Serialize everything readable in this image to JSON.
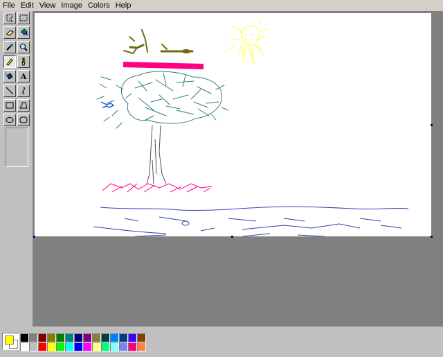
{
  "menu": {
    "items": [
      {
        "id": "file",
        "label": "File"
      },
      {
        "id": "edit",
        "label": "Edit"
      },
      {
        "id": "view",
        "label": "View"
      },
      {
        "id": "image",
        "label": "Image"
      },
      {
        "id": "colors",
        "label": "Colors"
      },
      {
        "id": "help",
        "label": "Help"
      }
    ]
  },
  "tools": [
    {
      "name": "free-form-select-tool",
      "icon": "free-form-select-icon",
      "pressed": false
    },
    {
      "name": "select-tool",
      "icon": "rect-select-icon",
      "pressed": false
    },
    {
      "name": "eraser-tool",
      "icon": "eraser-icon",
      "pressed": false
    },
    {
      "name": "fill-tool",
      "icon": "paint-bucket-icon",
      "pressed": false
    },
    {
      "name": "pick-color-tool",
      "icon": "eyedropper-icon",
      "pressed": false
    },
    {
      "name": "magnifier-tool",
      "icon": "magnifier-icon",
      "pressed": false
    },
    {
      "name": "pencil-tool",
      "icon": "pencil-icon",
      "pressed": true
    },
    {
      "name": "brush-tool",
      "icon": "brush-icon",
      "pressed": false
    },
    {
      "name": "airbrush-tool",
      "icon": "airbrush-icon",
      "pressed": false
    },
    {
      "name": "text-tool",
      "icon": "text-icon",
      "pressed": false
    },
    {
      "name": "line-tool",
      "icon": "line-icon",
      "pressed": false
    },
    {
      "name": "curve-tool",
      "icon": "curve-icon",
      "pressed": false
    },
    {
      "name": "rectangle-tool",
      "icon": "rectangle-icon",
      "pressed": false
    },
    {
      "name": "polygon-tool",
      "icon": "polygon-icon",
      "pressed": false
    },
    {
      "name": "ellipse-tool",
      "icon": "ellipse-icon",
      "pressed": false
    },
    {
      "name": "rounded-rectangle-tool",
      "icon": "rounded-rectangle-icon",
      "pressed": false
    }
  ],
  "text_tool_glyph": "A",
  "colors": {
    "foreground": "#ffff00",
    "background": "#ffffff",
    "palette_top": [
      "#000000",
      "#808080",
      "#800000",
      "#808000",
      "#008000",
      "#008080",
      "#000080",
      "#800080",
      "#808040",
      "#004040",
      "#0080ff",
      "#004080",
      "#4000ff",
      "#804000"
    ],
    "palette_bottom": [
      "#ffffff",
      "#c0c0c0",
      "#ff0000",
      "#ffff00",
      "#00ff00",
      "#00ffff",
      "#0000ff",
      "#ff00ff",
      "#ffff80",
      "#00ff80",
      "#80ffff",
      "#8080ff",
      "#ff0080",
      "#ff8040"
    ]
  }
}
